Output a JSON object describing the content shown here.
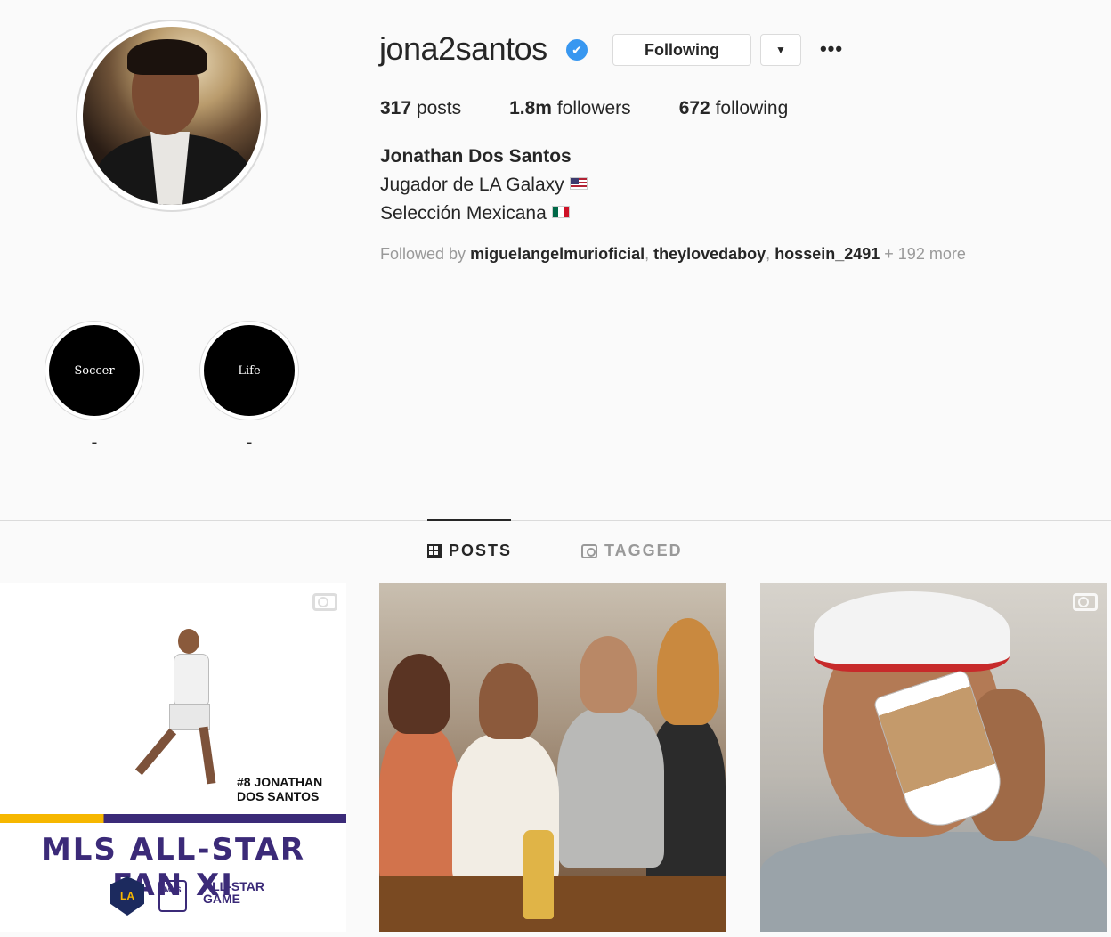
{
  "profile": {
    "username": "jona2santos",
    "verified_icon": "✔",
    "following_label": "Following",
    "dropdown_icon": "▼",
    "more_icon": "•••",
    "stats": {
      "posts_count": "317",
      "posts_label": "posts",
      "followers_count": "1.8m",
      "followers_label": "followers",
      "following_count": "672",
      "following_label": "following"
    },
    "full_name": "Jonathan Dos Santos",
    "bio_line1": "Jugador de LA Galaxy",
    "bio_line2": "Selección Mexicana",
    "followed_by_prefix": "Followed by",
    "followed_by_users": [
      "miguelangelmurioficial",
      "theylovedaboy",
      "hossein_2491"
    ],
    "followed_by_more": "+ 192 more"
  },
  "highlights": [
    {
      "cover_text": "Soccer",
      "label": "-"
    },
    {
      "cover_text": "Life",
      "label": "-"
    }
  ],
  "tabs": {
    "posts_label": "POSTS",
    "tagged_label": "TAGGED"
  },
  "posts": {
    "post1": {
      "jersey_text": "#8 JONATHAN DOS SANTOS",
      "headline": "MLS ALL-STAR FAN XI",
      "badge_la": "LA",
      "badge_mls": "MLS",
      "game_line1": "ALL-STAR",
      "game_line2": "GAME"
    }
  },
  "colors": {
    "background": "#fafafa",
    "verified_blue": "#3897f0",
    "muted_text": "#999999",
    "border": "#dbdbdb",
    "allstar_purple": "#3b2a78"
  }
}
